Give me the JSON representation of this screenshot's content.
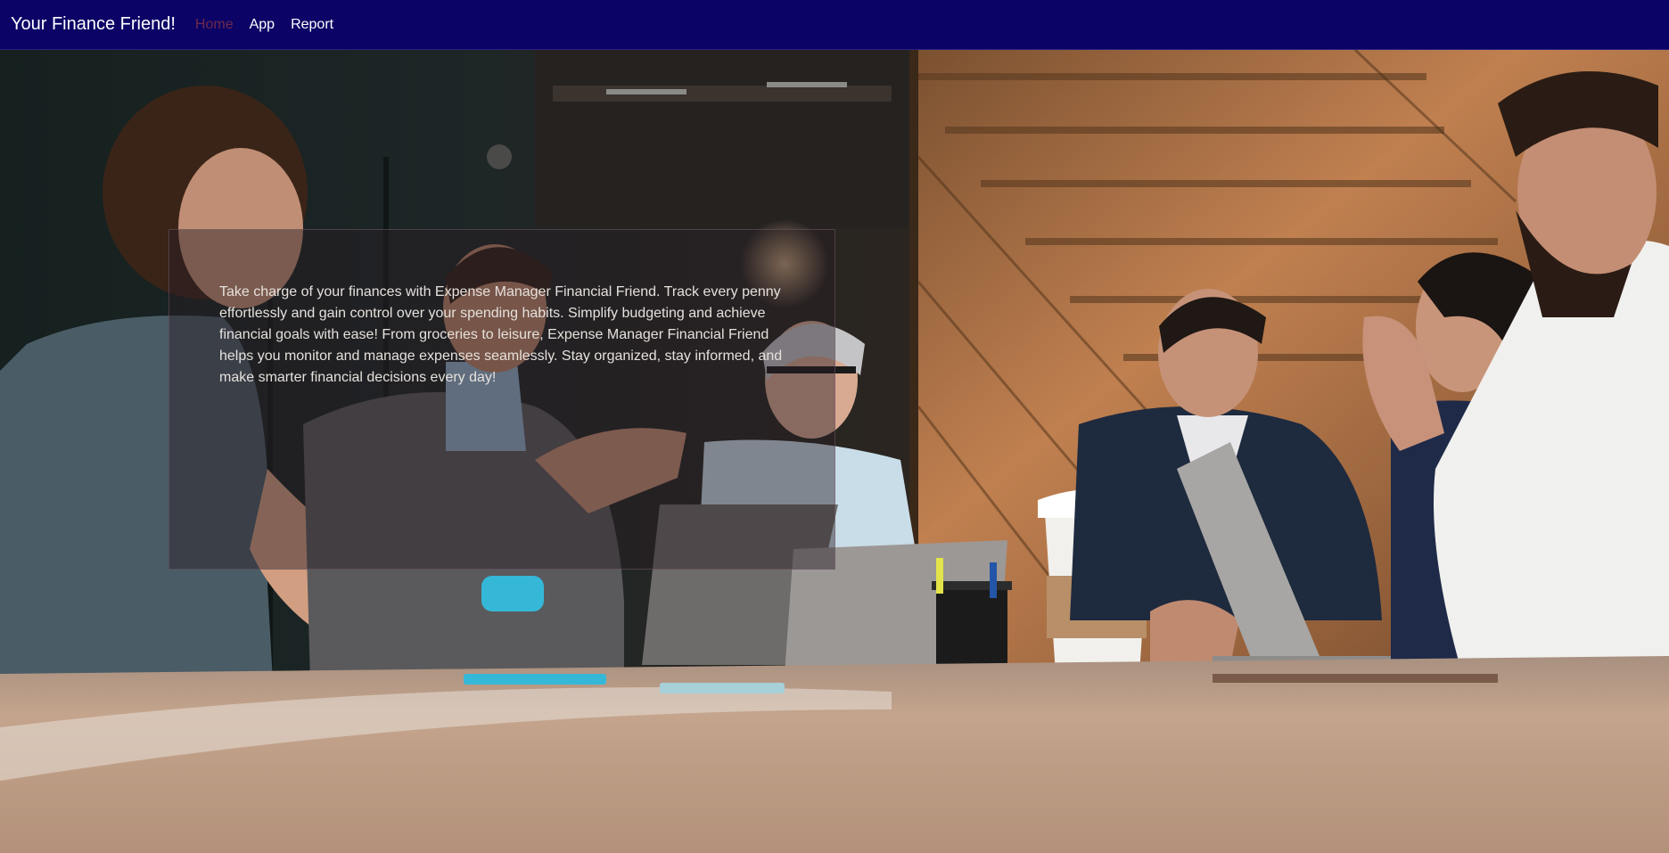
{
  "navbar": {
    "brand": "Your Finance Friend!",
    "links": [
      {
        "label": "Home",
        "active": true
      },
      {
        "label": "App",
        "active": false
      },
      {
        "label": "Report",
        "active": false
      }
    ],
    "background_color": "#0b0366",
    "active_link_color": "#6f2a4d"
  },
  "hero": {
    "description": "Take charge of your finances with Expense Manager Financial Friend. Track every penny effortlessly and gain control over your spending habits. Simplify budgeting and achieve financial goals with ease! From groceries to leisure, Expense Manager Financial Friend helps you monitor and manage expenses seamlessly. Stay organized, stay informed, and make smarter financial decisions every day!"
  }
}
